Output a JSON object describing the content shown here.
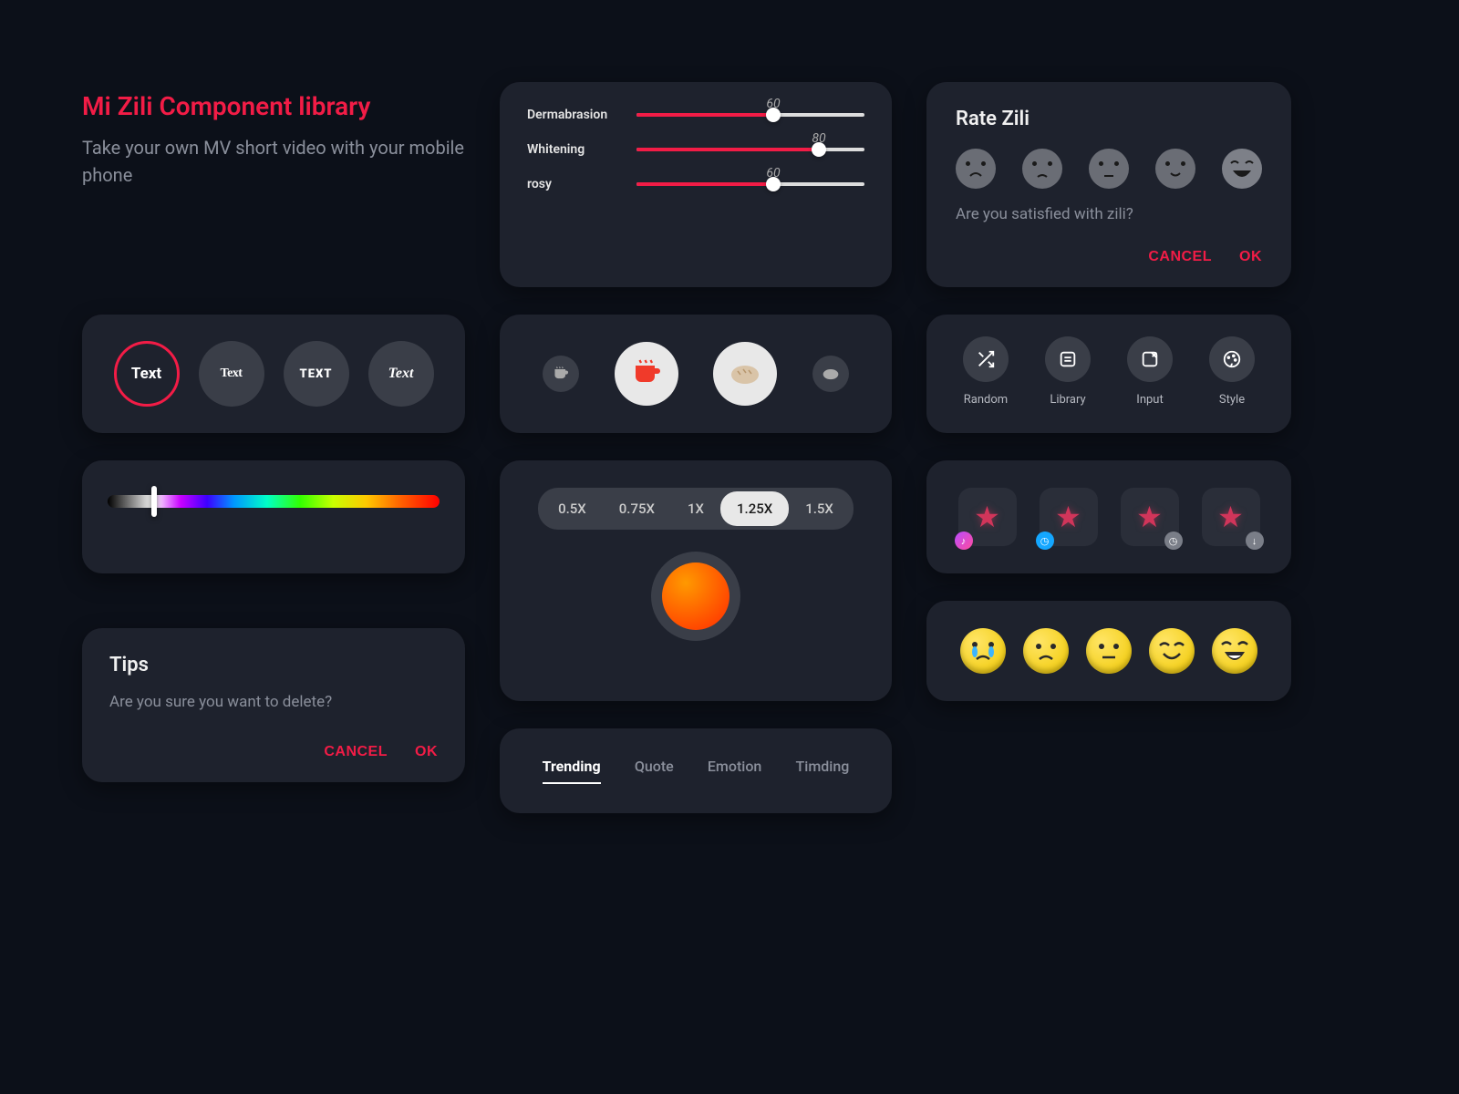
{
  "header": {
    "title": "Mi Zili Component library",
    "subtitle": "Take your own MV short video with your mobile phone"
  },
  "sliders": [
    {
      "label": "Dermabrasion",
      "value": 60
    },
    {
      "label": "Whitening",
      "value": 80
    },
    {
      "label": "rosy",
      "value": 60
    }
  ],
  "rate": {
    "title": "Rate Zili",
    "question": "Are you satisfied with zili?",
    "cancel": "CANCEL",
    "ok": "OK",
    "faces": [
      "crying",
      "sad",
      "neutral",
      "happy",
      "laughing"
    ]
  },
  "text_styles": [
    {
      "label": "Text",
      "style": "normal"
    },
    {
      "label": "Text",
      "style": "condensed"
    },
    {
      "label": "TEXT",
      "style": "bold"
    },
    {
      "label": "Text",
      "style": "italic"
    }
  ],
  "text_styles_selected": 0,
  "icon_scales": [
    "cup-icon",
    "cup-icon",
    "bread-icon",
    "bread-icon"
  ],
  "color_slider_pos": 14,
  "actions": [
    {
      "icon": "shuffle-icon",
      "label": "Random"
    },
    {
      "icon": "library-icon",
      "label": "Library"
    },
    {
      "icon": "input-icon",
      "label": "Input"
    },
    {
      "icon": "style-icon",
      "label": "Style"
    }
  ],
  "speed": {
    "options": [
      "0.5X",
      "0.75X",
      "1X",
      "1.25X",
      "1.5X"
    ],
    "active": 3
  },
  "effects_badges": [
    "music",
    "clock-blue",
    "clock-gray",
    "download"
  ],
  "tips": {
    "title": "Tips",
    "question": "Are you sure you want to delete?",
    "cancel": "CANCEL",
    "ok": "OK"
  },
  "emoji_faces": [
    "crying",
    "sad",
    "neutral",
    "happy",
    "laughing"
  ],
  "tabs": {
    "items": [
      "Trending",
      "Quote",
      "Emotion",
      "Timding"
    ],
    "active": 0
  },
  "colors": {
    "accent": "#f21c46"
  }
}
